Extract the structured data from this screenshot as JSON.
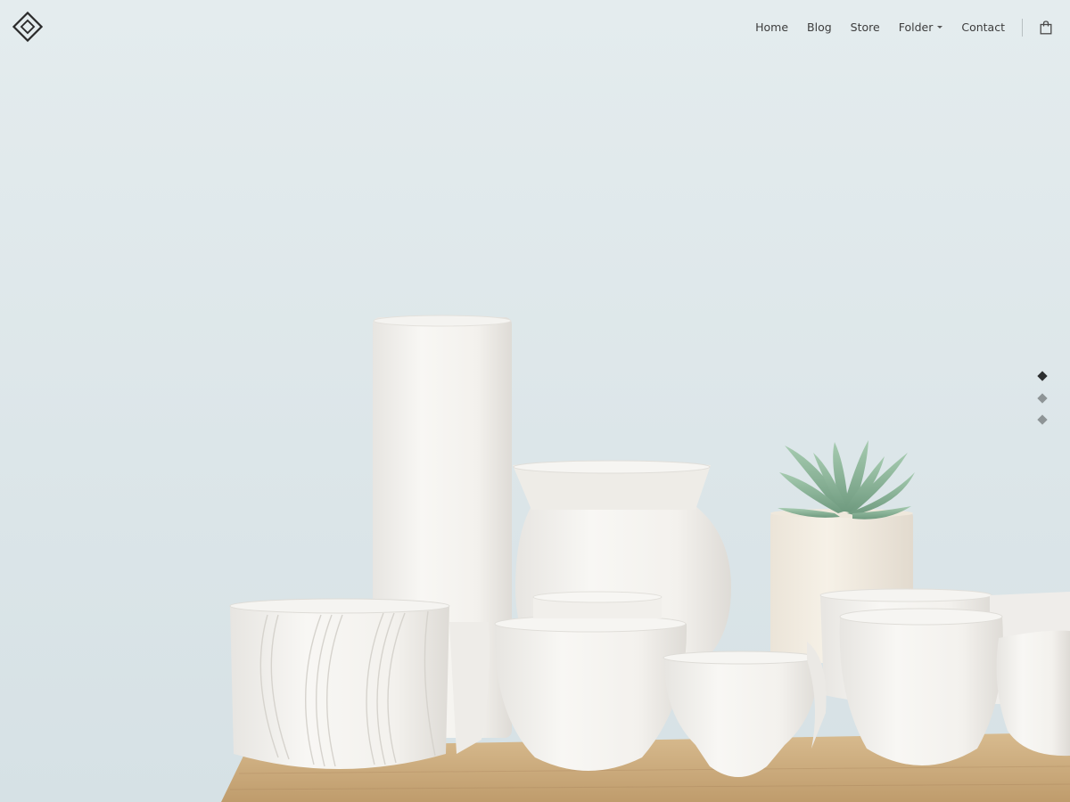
{
  "header": {
    "logo_icon": "diamond-logo-icon",
    "nav": [
      {
        "label": "Home"
      },
      {
        "label": "Blog"
      },
      {
        "label": "Store"
      },
      {
        "label": "Folder",
        "has_dropdown": true,
        "icon": "chevron-down-icon"
      },
      {
        "label": "Contact"
      }
    ],
    "cart_icon": "shopping-bag-icon"
  },
  "hero": {
    "image_subject": "white ceramic pots and vases with succulent on wooden table",
    "slide_count": 3,
    "active_slide": 1
  },
  "colors": {
    "background": "#dde7ea",
    "nav_text": "#3d3d3d",
    "dot_active": "#2c2e2f",
    "dot_inactive": "#8e9496",
    "table_wood": "#c9a97b",
    "ceramic": "#f3f1ed",
    "succulent": "#8fb79c"
  }
}
